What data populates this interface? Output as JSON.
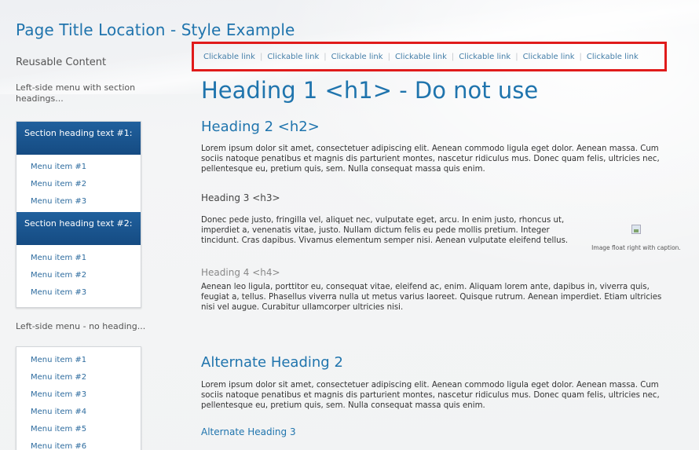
{
  "page": {
    "title": "Page Title Location - Style Example"
  },
  "topnav": {
    "links": [
      "Clickable link",
      "Clickable link",
      "Clickable link",
      "Clickable link",
      "Clickable link",
      "Clickable link",
      "Clickable link"
    ]
  },
  "sidebar": {
    "reusable_label": "Reusable Content",
    "menu_with_headings_note": "Left-side menu with section headings...",
    "section1": {
      "heading": "Section heading text #1:",
      "items": [
        "Menu item #1",
        "Menu item #2",
        "Menu item #3"
      ]
    },
    "section2": {
      "heading": "Section heading text #2:",
      "items": [
        "Menu item #1",
        "Menu item #2",
        "Menu item #3"
      ]
    },
    "no_heading_note": "Left-side menu - no heading...",
    "plain_menu": {
      "items": [
        "Menu item #1",
        "Menu item #2",
        "Menu item #3",
        "Menu item #4",
        "Menu item #5",
        "Menu item #6"
      ]
    }
  },
  "main": {
    "h1": "Heading 1 <h1> - Do not use",
    "h2": "Heading 2 <h2>",
    "p1": "Lorem ipsum dolor sit amet, consectetuer adipiscing elit. Aenean commodo ligula eget dolor. Aenean massa. Cum sociis natoque penatibus et magnis dis parturient montes, nascetur ridiculus mus. Donec quam felis, ultricies nec, pellentesque eu, pretium quis, sem. Nulla consequat massa quis enim.",
    "h3": "Heading 3 <h3>",
    "p2": "Donec pede justo, fringilla vel, aliquet nec, vulputate eget, arcu. In enim justo, rhoncus ut, imperdiet a, venenatis vitae, justo. Nullam dictum felis eu pede mollis pretium. Integer tincidunt. Cras dapibus. Vivamus elementum semper nisi. Aenean vulputate eleifend tellus.",
    "image_caption": "Image float right with caption.",
    "h4": "Heading 4 <h4>",
    "p3": "Aenean leo ligula, porttitor eu, consequat vitae, eleifend ac, enim. Aliquam lorem ante, dapibus in, viverra quis, feugiat a, tellus. Phasellus viverra nulla ut metus varius laoreet. Quisque rutrum. Aenean imperdiet. Etiam ultricies nisi vel augue. Curabitur ullamcorper ultricies nisi.",
    "alt_h2": "Alternate Heading 2",
    "p4": "Lorem ipsum dolor sit amet, consectetuer adipiscing elit. Aenean commodo ligula eget dolor. Aenean massa. Cum sociis natoque penatibus et magnis dis parturient montes, nascetur ridiculus mus. Donec quam felis, ultricies nec, pellentesque eu, pretium quis, sem. Nulla consequat massa quis enim.",
    "alt_h3": "Alternate Heading 3"
  },
  "colors": {
    "brand_blue": "#1f74ad",
    "section_heading_bg": "#154b82",
    "highlight_border": "#e01b1b",
    "link": "#447ea8"
  }
}
